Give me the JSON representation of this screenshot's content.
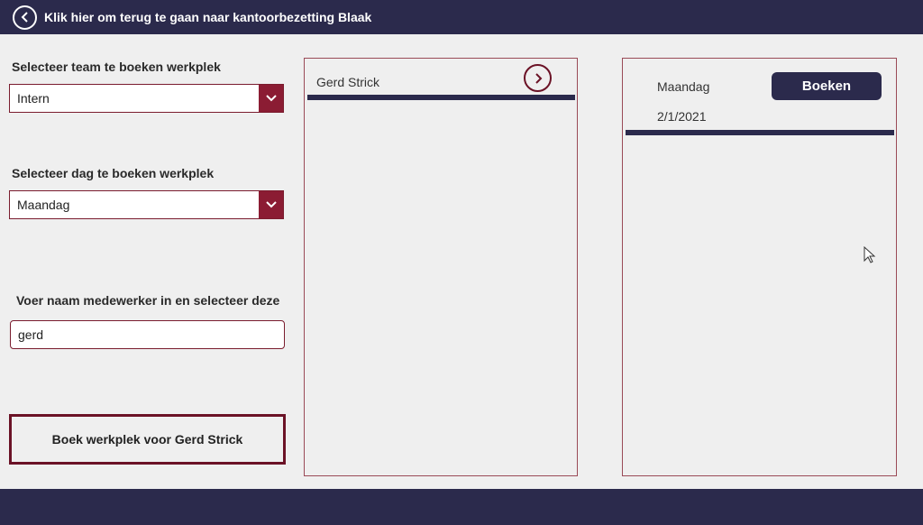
{
  "header": {
    "title": "Klik hier om terug te gaan naar kantoorbezetting Blaak",
    "icon": "back-arrow-icon"
  },
  "form": {
    "team_label": "Selecteer team te boeken werkplek",
    "team_value": "Intern",
    "day_label": "Selecteer dag te boeken werkplek",
    "day_value": "Maandag",
    "name_label": "Voer naam medewerker in en selecteer deze",
    "name_value": "gerd",
    "book_button": "Boek werkplek voor Gerd Strick"
  },
  "employees": {
    "items": [
      {
        "name": "Gerd  Strick"
      }
    ]
  },
  "booking": {
    "day": "Maandag",
    "date": "2/1/2021",
    "button": "Boeken"
  },
  "colors": {
    "header_bg": "#2b2a4c",
    "accent": "#8b1c33",
    "background": "#efefef"
  }
}
